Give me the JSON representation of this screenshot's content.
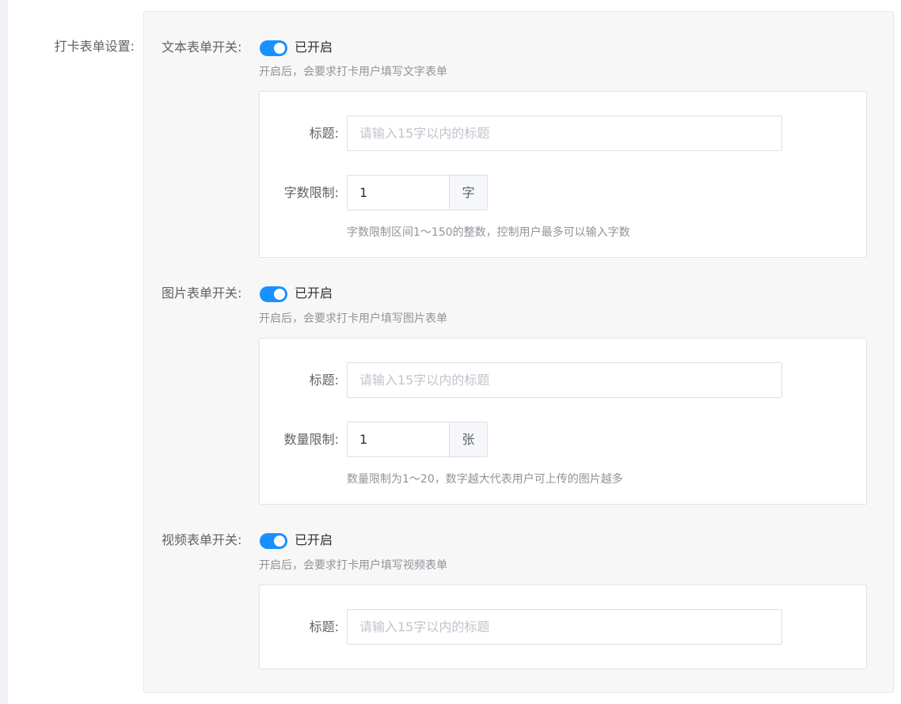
{
  "main_label": "打卡表单设置:",
  "sections": [
    {
      "switch_label": "文本表单开关:",
      "switch_state": "已开启",
      "hint": "开启后，会要求打卡用户填写文字表单",
      "title_label": "标题:",
      "title_placeholder": "请输入15字以内的标题",
      "limit_label": "字数限制:",
      "limit_value": "1",
      "unit": "字",
      "limit_hint": "字数限制区间1～150的整数，控制用户最多可以输入字数"
    },
    {
      "switch_label": "图片表单开关:",
      "switch_state": "已开启",
      "hint": "开启后，会要求打卡用户填写图片表单",
      "title_label": "标题:",
      "title_placeholder": "请输入15字以内的标题",
      "limit_label": "数量限制:",
      "limit_value": "1",
      "unit": "张",
      "limit_hint": "数量限制为1～20，数字越大代表用户可上传的图片越多"
    },
    {
      "switch_label": "视频表单开关:",
      "switch_state": "已开启",
      "hint": "开启后，会要求打卡用户填写视频表单",
      "title_label": "标题:",
      "title_placeholder": "请输入15字以内的标题"
    }
  ],
  "colors": {
    "accent": "#1890ff",
    "panel_bg": "#f7f7f7"
  }
}
